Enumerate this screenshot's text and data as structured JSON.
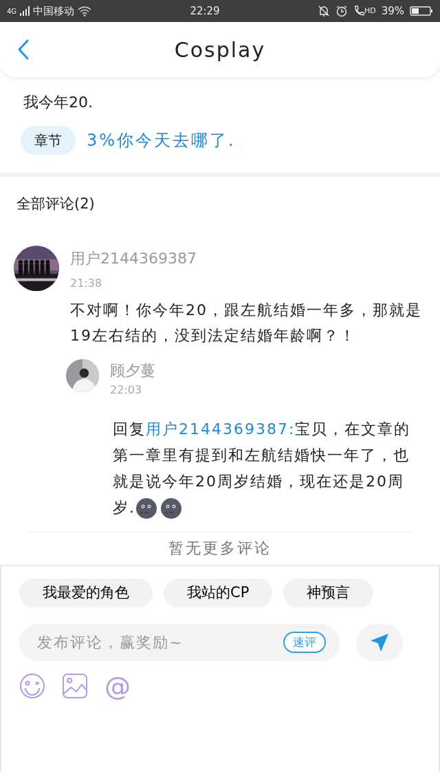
{
  "status_bar": {
    "network": "4G",
    "carrier": "中国移动",
    "time": "22:29",
    "call_label": "HD",
    "battery": "39%"
  },
  "header": {
    "title": "Cosplay"
  },
  "post": {
    "text": "我今年20.",
    "chapter_tag": "章节",
    "chapter_title": "3%你今天去哪了."
  },
  "comments_heading": "全部评论(2)",
  "comments": [
    {
      "user": "用户2144369387",
      "time": "21:38",
      "text": "不对啊！你今年20，跟左航结婚一年多，那就是19左右结的，没到法定结婚年龄啊？！",
      "replies": [
        {
          "user": "顾夕蔓",
          "time": "22:03",
          "reply_prefix": "回复",
          "reply_to": "用户2144369387:",
          "text": "宝贝，在文章的第一章里有提到和左航结婚快一年了，也就是说今年20周岁结婚，现在还是20周岁.",
          "emojis": [
            {
              "kind": "moon"
            },
            {
              "kind": "moon"
            }
          ]
        }
      ]
    }
  ],
  "end_note": "暂无更多评论",
  "quick_tags": [
    "我最爱的角色",
    "我站的CP",
    "神预言"
  ],
  "composer": {
    "placeholder": "发布评论，赢奖励~",
    "quick_button": "速评",
    "mention_icon": "@"
  }
}
